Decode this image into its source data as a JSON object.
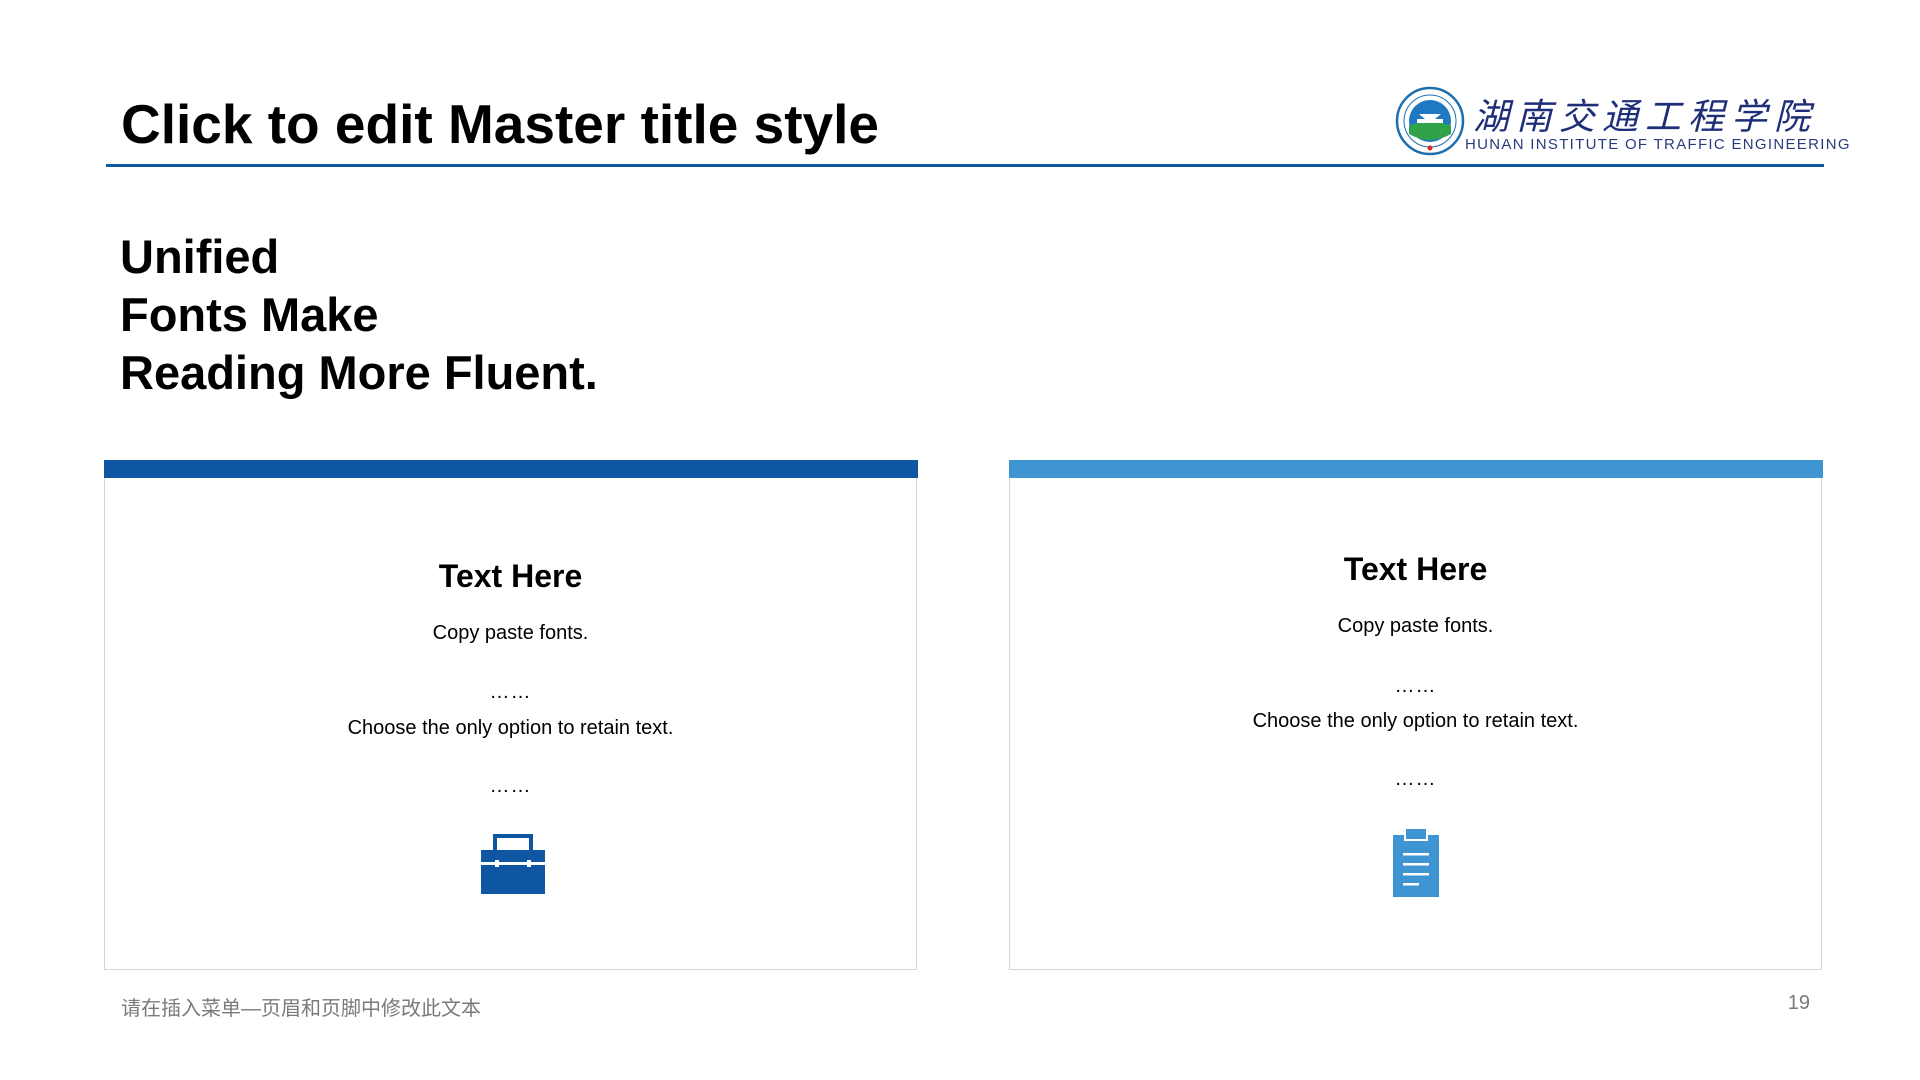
{
  "slide": {
    "title": "Click to edit Master title style",
    "heading_lines": [
      "Unified",
      "Fonts Make",
      "Reading More Fluent."
    ],
    "logo": {
      "name_cn": "湖南交通工程学院",
      "name_en": "HUNAN INSTITUTE OF TRAFFIC ENGINEERING"
    },
    "cards": [
      {
        "title": "Text Here",
        "line1": "Copy paste fonts.",
        "dots1": "……",
        "line2": "Choose the only option to retain text.",
        "dots2": "……",
        "icon": "toolbox-icon",
        "accent": "#0e56a2"
      },
      {
        "title": "Text Here",
        "line1": "Copy paste fonts.",
        "dots1": "……",
        "line2": "Choose the only option to retain text.",
        "dots2": "……",
        "icon": "clipboard-icon",
        "accent": "#3f95d2"
      }
    ],
    "footer_text": "请在插入菜单—页眉和页脚中修改此文本",
    "page_number": "19"
  },
  "colors": {
    "primary_blue": "#0e56a2",
    "light_blue": "#3f95d2",
    "rule": "#0e56a2",
    "footer_gray": "#7a7a7a"
  }
}
